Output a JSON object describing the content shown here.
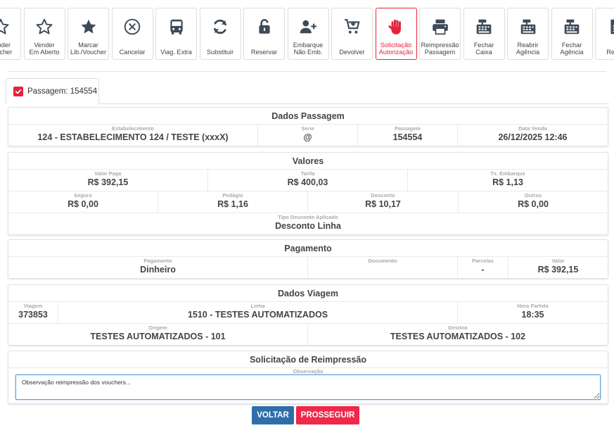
{
  "toolbar": {
    "buttons": [
      {
        "label": "Vender\nVoucher",
        "icon": "star-outline-icon"
      },
      {
        "label": "Vender\nEm Aberto",
        "icon": "star-outline-icon"
      },
      {
        "label": "Marcar\nLib./Voucher",
        "icon": "star-solid-icon"
      },
      {
        "label": "Cancelar",
        "icon": "circle-x-icon"
      },
      {
        "label": "Viag. Extra",
        "icon": "bus-icon"
      },
      {
        "label": "Substituir",
        "icon": "refresh-icon"
      },
      {
        "label": "Reservar",
        "icon": "unlock-icon"
      },
      {
        "label": "Embarque\nNão Emb.",
        "icon": "user-plus-icon"
      },
      {
        "label": "Devolver",
        "icon": "cart-return-icon"
      },
      {
        "label": "Solicitação\nAutorização",
        "icon": "hand-stop-icon"
      },
      {
        "label": "Reimpressão\nPassagem",
        "icon": "printer-icon"
      },
      {
        "label": "Fechar\nCaixa",
        "icon": "cash-register-icon"
      },
      {
        "label": "Reabrir\nAgência",
        "icon": "cash-register-icon"
      },
      {
        "label": "Fechar\nAgência",
        "icon": "cash-register-icon"
      },
      {
        "label": "Relató",
        "icon": "report-icon"
      }
    ],
    "active_color": "#e5243b"
  },
  "tab": {
    "label": "Passagem: 154554",
    "checked": true
  },
  "dados_passagem": {
    "title": "Dados Passagem",
    "estabelecimento_label": "Estabelecimento",
    "estabelecimento": "124 - ESTABELECIMENTO 124 / TESTE (xxxX)",
    "serie_label": "Serie",
    "serie": "@",
    "passagem_label": "Passagem",
    "passagem": "154554",
    "data_venda_label": "Data Venda",
    "data_venda": "26/12/2025 12:46"
  },
  "valores": {
    "title": "Valores",
    "valor_pago_label": "Valor Pago",
    "valor_pago": "R$ 392,15",
    "tarifa_label": "Tarifa",
    "tarifa": "R$ 400,03",
    "tx_embarque_label": "Tx. Embarque",
    "tx_embarque": "R$ 1,13",
    "seguro_label": "Seguro",
    "seguro": "R$ 0,00",
    "pedagio_label": "Pedágio",
    "pedagio": "R$ 1,16",
    "desconto_label": "Desconto",
    "desconto": "R$ 10,17",
    "outros_label": "Outros",
    "outros": "R$ 0,00",
    "tipo_desconto_label": "Tipo Desconto Aplicado",
    "tipo_desconto": "Desconto Linha"
  },
  "pagamento": {
    "title": "Pagamento",
    "pagamento_label": "Pagamento",
    "pagamento": "Dinheiro",
    "documento_label": "Documento",
    "documento": "",
    "parcelas_label": "Parcelas",
    "parcelas": "-",
    "valor_label": "Valor",
    "valor": "R$ 392,15"
  },
  "dados_viagem": {
    "title": "Dados Viagem",
    "viagem_label": "Viagem",
    "viagem": "373853",
    "linha_label": "Linha",
    "linha": "1510 - TESTES AUTOMATIZADOS",
    "hora_partida_label": "Hora Partida",
    "hora_partida": "18:35",
    "origem_label": "Origem",
    "origem": "TESTES AUTOMATIZADOS - 101",
    "destino_label": "Destino",
    "destino": "TESTES AUTOMATIZADOS - 102"
  },
  "reimpressao": {
    "title": "Solicitação de Reimpressão",
    "observacao_label": "Observação",
    "observacao": "Observação reimpressão dos vouchers..."
  },
  "actions": {
    "voltar": "VOLTAR",
    "prosseguir": "PROSSEGUIR"
  },
  "colors": {
    "primary": "#2f6fa9",
    "danger": "#f02849",
    "accent_red": "#e5243b"
  }
}
